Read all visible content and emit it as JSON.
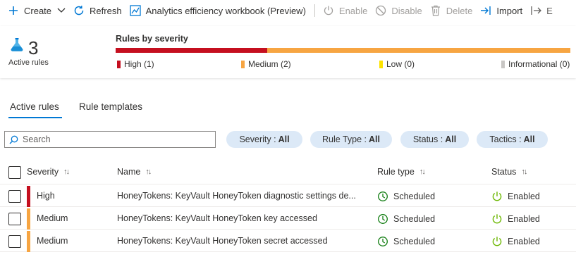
{
  "toolbar": {
    "create": "Create",
    "refresh": "Refresh",
    "workbook": "Analytics efficiency workbook (Preview)",
    "enable": "Enable",
    "disable": "Disable",
    "delete": "Delete",
    "import": "Import",
    "export": "E"
  },
  "summary": {
    "active_count": "3",
    "active_label": "Active rules",
    "severity_title": "Rules by severity",
    "severity_counts": {
      "high": 1,
      "medium": 2,
      "low": 0,
      "informational": 0
    },
    "legend": {
      "high": "High (1)",
      "medium": "Medium (2)",
      "low": "Low (0)",
      "informational": "Informational (0)"
    }
  },
  "colors": {
    "high": "#c50f1f",
    "medium": "#f7a542",
    "low": "#fde300",
    "informational": "#c8c6c4",
    "accent": "#0078d4",
    "scheduled": "#107c10",
    "enabled": "#6bb700"
  },
  "tabs": [
    {
      "label": "Active rules",
      "active": true
    },
    {
      "label": "Rule templates",
      "active": false
    }
  ],
  "search": {
    "placeholder": "Search",
    "value": ""
  },
  "filters": [
    {
      "label": "Severity :",
      "value": "All"
    },
    {
      "label": "Rule Type :",
      "value": "All"
    },
    {
      "label": "Status :",
      "value": "All"
    },
    {
      "label": "Tactics :",
      "value": "All"
    }
  ],
  "table": {
    "columns": {
      "severity": "Severity",
      "name": "Name",
      "rule_type": "Rule type",
      "status": "Status"
    },
    "sort_icon": "↑↓",
    "rows": [
      {
        "severity": "High",
        "name": "HoneyTokens: KeyVault HoneyToken diagnostic settings de...",
        "rule_type": "Scheduled",
        "status": "Enabled"
      },
      {
        "severity": "Medium",
        "name": "HoneyTokens: KeyVault HoneyToken key accessed",
        "rule_type": "Scheduled",
        "status": "Enabled"
      },
      {
        "severity": "Medium",
        "name": "HoneyTokens: KeyVault HoneyToken secret accessed",
        "rule_type": "Scheduled",
        "status": "Enabled"
      }
    ]
  },
  "icons": {
    "create": "plus-icon",
    "refresh": "refresh-icon",
    "workbook": "chart-icon",
    "enable": "power-icon",
    "disable": "block-icon",
    "delete": "trash-icon",
    "import": "import-icon",
    "export": "export-icon",
    "active_rules": "flask-icon",
    "search": "search-icon",
    "scheduled": "clock-icon",
    "enabled": "power-icon"
  }
}
